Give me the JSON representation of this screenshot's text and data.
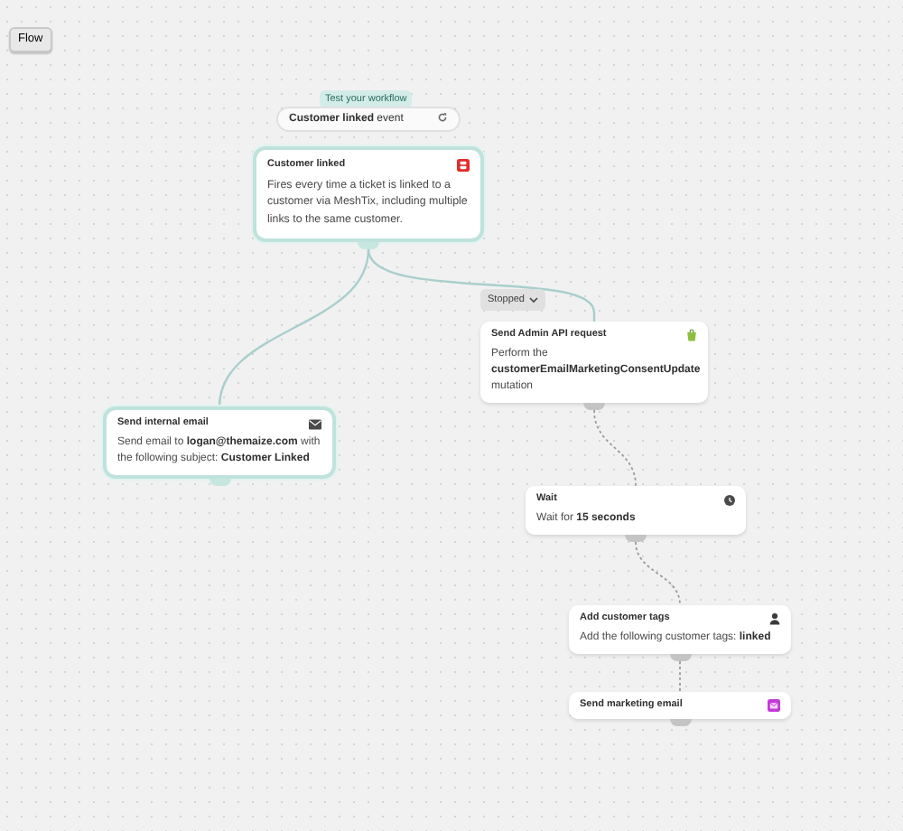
{
  "toolbar": {
    "button": "Flow"
  },
  "test_label": "Test your workflow",
  "event_pill": {
    "text": "**Customer linked** event"
  },
  "status_dropdown": {
    "label": "Stopped"
  },
  "nodes": [
    {
      "kind": "trigger",
      "title": "Customer linked",
      "description": "Fires every time a ticket is linked to a customer via MeshTix, including multiple links to the same customer.",
      "highlighted": true
    },
    {
      "kind": "action",
      "title": "Send Admin API request",
      "description": "Perform the **customerEmailMarketingConsentUpdate** mutation",
      "highlighted": false
    },
    {
      "kind": "action",
      "title": "Send internal email",
      "description": "Send email to **logan@themaize.com** with the following subject: **Customer Linked**",
      "highlighted": true
    },
    {
      "kind": "action",
      "title": "Wait",
      "description": "Wait for **15 seconds**",
      "highlighted": false
    },
    {
      "kind": "action",
      "title": "Add customer tags",
      "description": "Add the following customer tags: **linked**",
      "highlighted": false
    },
    {
      "kind": "action",
      "title": "Send marketing email",
      "highlighted": false
    }
  ]
}
